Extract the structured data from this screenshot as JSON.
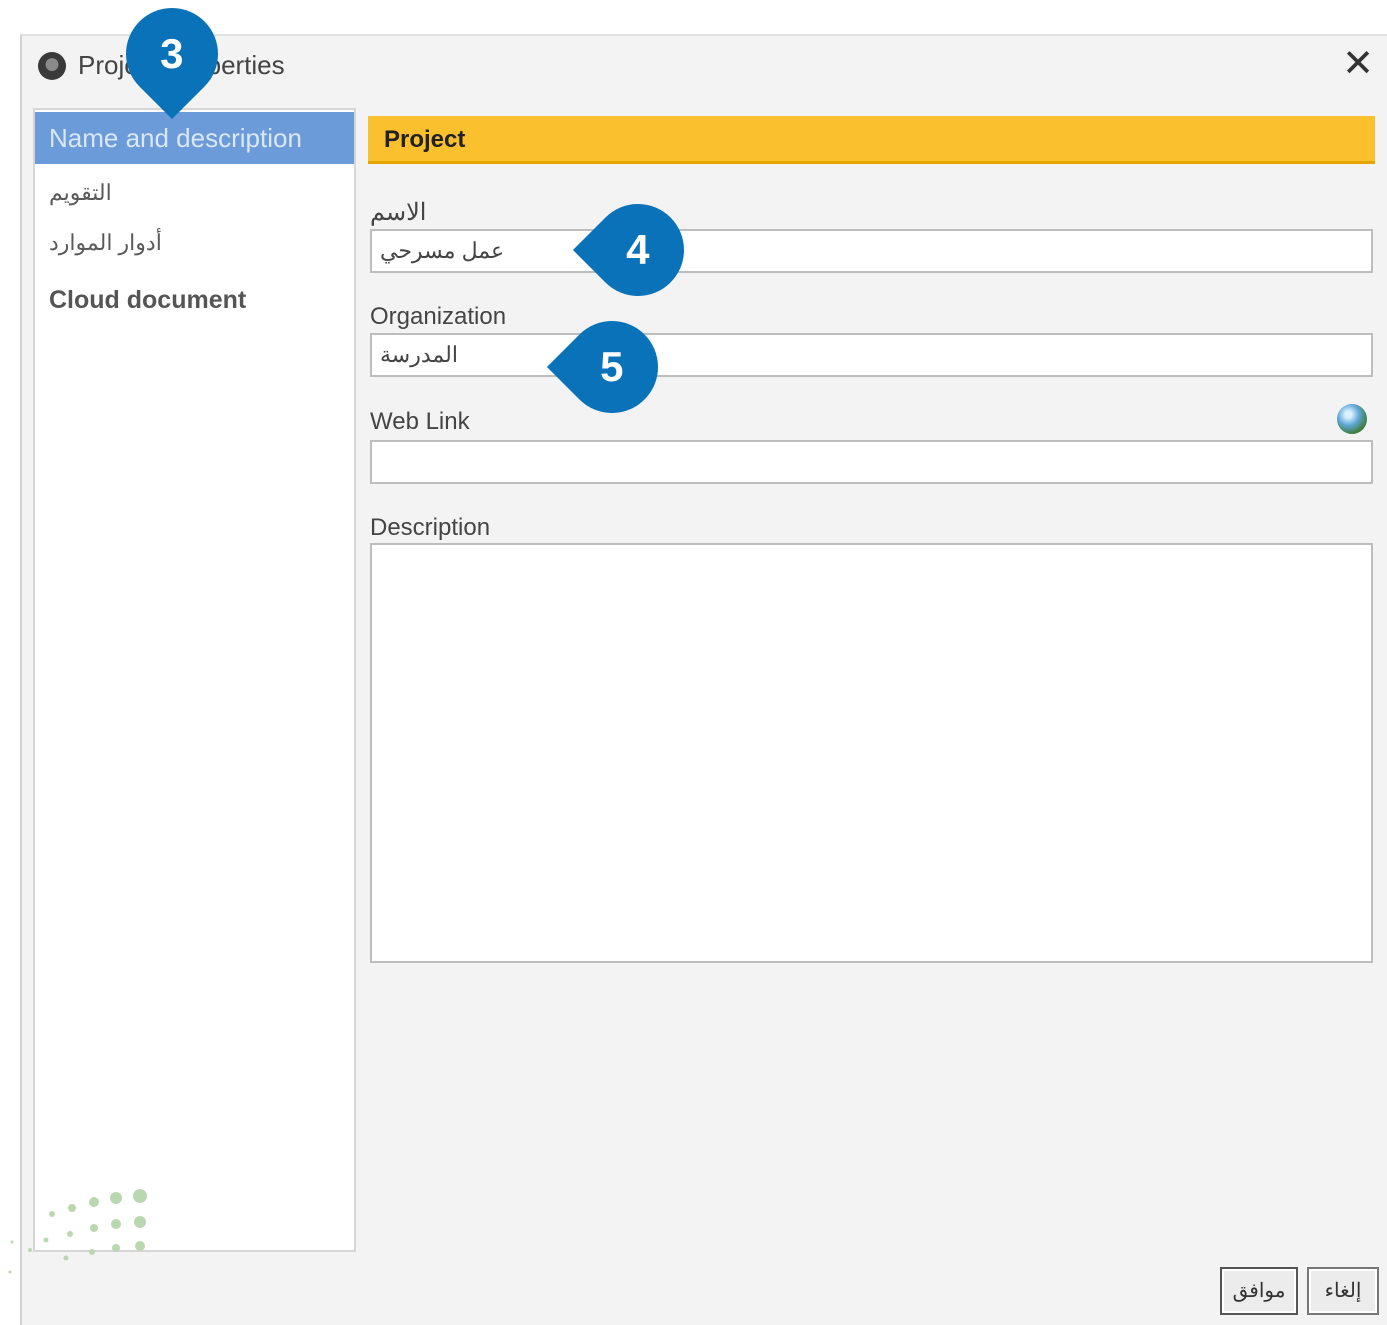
{
  "window": {
    "title": "Project Properties",
    "close_glyph": "✕"
  },
  "sidebar": {
    "items": [
      {
        "label": "Name and description"
      },
      {
        "label": "التقويم"
      },
      {
        "label": "أدوار الموارد"
      },
      {
        "label": "Cloud document"
      }
    ]
  },
  "main": {
    "section_title": "Project",
    "fields": {
      "name": {
        "label": "الاسم",
        "value": "عمل مسرحي"
      },
      "organization": {
        "label": "Organization",
        "value": "المدرسة"
      },
      "web_link": {
        "label": "Web Link",
        "value": ""
      },
      "description": {
        "label": "Description",
        "value": ""
      }
    }
  },
  "buttons": {
    "ok": "موافق",
    "cancel": "إلغاء"
  },
  "markers": [
    "3",
    "4",
    "5"
  ],
  "colors": {
    "selected_item": "#6b9bd8",
    "section_bar": "#fbc02d",
    "marker": "#0a72b8"
  }
}
